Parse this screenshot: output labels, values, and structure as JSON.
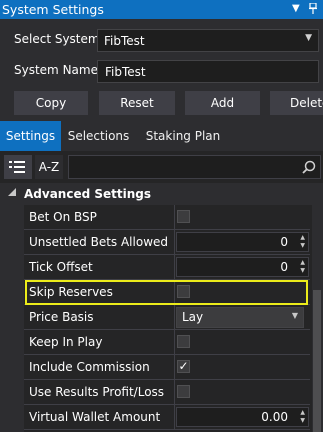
{
  "window": {
    "title": "System Settings",
    "icons": [
      "dropdown-arrow-icon",
      "pin-icon"
    ]
  },
  "form": {
    "select_system_label": "Select System:",
    "select_system_value": "FibTest",
    "system_name_label": "System Name:",
    "system_name_value": "FibTest"
  },
  "buttons": {
    "copy": "Copy",
    "reset": "Reset",
    "add": "Add",
    "delete": "Delete"
  },
  "tabs": [
    {
      "label": "Settings",
      "active": true
    },
    {
      "label": "Selections",
      "active": false
    },
    {
      "label": "Staking Plan",
      "active": false
    }
  ],
  "toolbar": {
    "sort_alpha_label": "A-Z",
    "search_value": ""
  },
  "category": {
    "title": "Advanced Settings"
  },
  "properties": [
    {
      "name": "Bet On BSP",
      "type": "checkbox",
      "checked": false
    },
    {
      "name": "Unsettled Bets Allowed",
      "type": "number",
      "value": "0"
    },
    {
      "name": "Tick Offset",
      "type": "number",
      "value": "0"
    },
    {
      "name": "Skip Reserves",
      "type": "checkbox",
      "checked": false,
      "highlighted": true
    },
    {
      "name": "Price Basis",
      "type": "dropdown",
      "value": "Lay"
    },
    {
      "name": "Keep In Play",
      "type": "checkbox",
      "checked": false
    },
    {
      "name": "Include Commission",
      "type": "checkbox",
      "checked": true
    },
    {
      "name": "Use Results Profit/Loss",
      "type": "checkbox",
      "checked": false
    },
    {
      "name": "Virtual Wallet Amount",
      "type": "number",
      "value": "0.00"
    }
  ],
  "colors": {
    "accent": "#0e70c0",
    "highlight": "#ecec1a",
    "background": "#252526"
  }
}
